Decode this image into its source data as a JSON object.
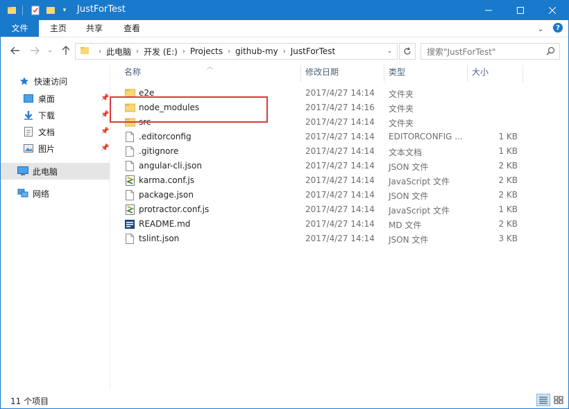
{
  "window": {
    "title": "JustForTest"
  },
  "ribbon": {
    "tabs": [
      "文件",
      "主页",
      "共享",
      "查看"
    ]
  },
  "address": {
    "crumbs": [
      "此电脑",
      "开发 (E:)",
      "Projects",
      "github-my",
      "JustForTest"
    ],
    "search_placeholder": "搜索\"JustForTest\""
  },
  "nav": {
    "quick_access": "快速访问",
    "items": [
      "桌面",
      "下载",
      "文档",
      "图片"
    ],
    "this_pc": "此电脑",
    "network": "网络"
  },
  "columns": {
    "name": "名称",
    "date": "修改日期",
    "type": "类型",
    "size": "大小"
  },
  "files": [
    {
      "name": "e2e",
      "date": "2017/4/27 14:14",
      "type": "文件夹",
      "size": "",
      "icon": "folder-icon"
    },
    {
      "name": "node_modules",
      "date": "2017/4/27 14:16",
      "type": "文件夹",
      "size": "",
      "icon": "folder-icon"
    },
    {
      "name": "src",
      "date": "2017/4/27 14:14",
      "type": "文件夹",
      "size": "",
      "icon": "folder-icon"
    },
    {
      "name": ".editorconfig",
      "date": "2017/4/27 14:14",
      "type": "EDITORCONFIG ...",
      "size": "1 KB",
      "icon": "file-icon"
    },
    {
      "name": ".gitignore",
      "date": "2017/4/27 14:14",
      "type": "文本文档",
      "size": "1 KB",
      "icon": "file-icon"
    },
    {
      "name": "angular-cli.json",
      "date": "2017/4/27 14:14",
      "type": "JSON 文件",
      "size": "2 KB",
      "icon": "file-icon"
    },
    {
      "name": "karma.conf.js",
      "date": "2017/4/27 14:14",
      "type": "JavaScript 文件",
      "size": "2 KB",
      "icon": "js-file-icon"
    },
    {
      "name": "package.json",
      "date": "2017/4/27 14:14",
      "type": "JSON 文件",
      "size": "2 KB",
      "icon": "file-icon"
    },
    {
      "name": "protractor.conf.js",
      "date": "2017/4/27 14:14",
      "type": "JavaScript 文件",
      "size": "1 KB",
      "icon": "js-file-icon"
    },
    {
      "name": "README.md",
      "date": "2017/4/27 14:14",
      "type": "MD 文件",
      "size": "2 KB",
      "icon": "md-file-icon"
    },
    {
      "name": "tslint.json",
      "date": "2017/4/27 14:14",
      "type": "JSON 文件",
      "size": "3 KB",
      "icon": "file-icon"
    }
  ],
  "status": {
    "count": "11 个项目"
  }
}
